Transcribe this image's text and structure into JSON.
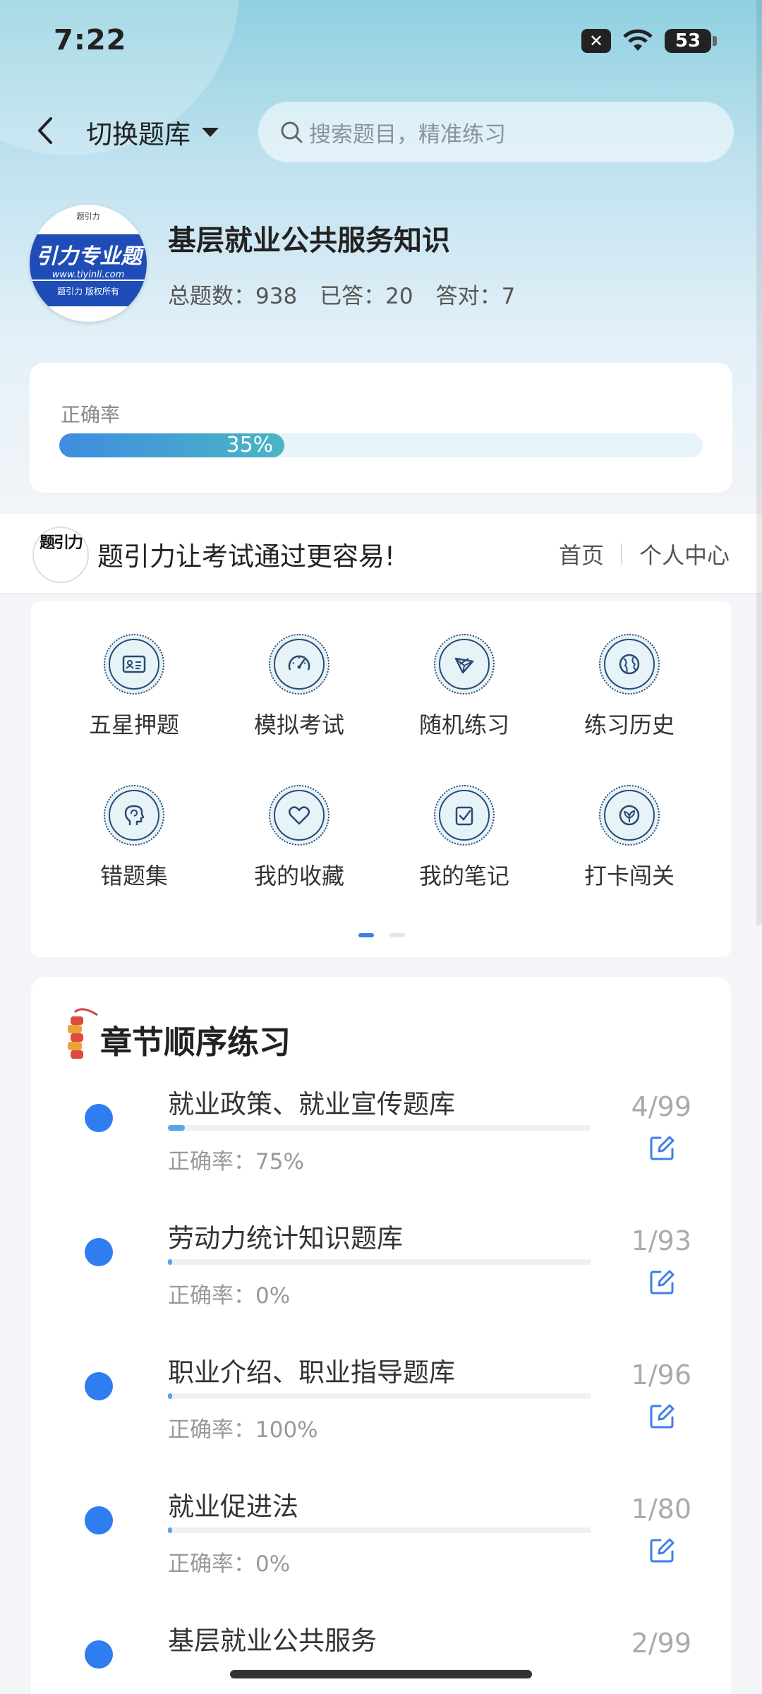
{
  "status_bar": {
    "time": "7:22",
    "battery": "53"
  },
  "topbar": {
    "switch_label": "切换题库",
    "search_placeholder": "搜索题目，精准练习"
  },
  "book": {
    "logo_top": "题引力",
    "logo_text": "引力专业题",
    "logo_url": "www.tiyinli.com",
    "logo_bottom": "题引力 版权所有",
    "title": "基层就业公共服务知识",
    "total_label": "总题数：938",
    "answered_label": "已答：20",
    "correct_label": "答对：7"
  },
  "accuracy": {
    "label": "正确率",
    "value_text": "35%",
    "value": 0.35
  },
  "banner": {
    "logo_text": "题引力",
    "slogan": "题引力让考试通过更容易!",
    "links": [
      "首页",
      "个人中心"
    ]
  },
  "grid": {
    "items": [
      {
        "label": "五星押题",
        "icon": "id-card-icon"
      },
      {
        "label": "模拟考试",
        "icon": "speedometer-icon"
      },
      {
        "label": "随机练习",
        "icon": "shuffle-icon"
      },
      {
        "label": "练习历史",
        "icon": "globe-icon"
      },
      {
        "label": "错题集",
        "icon": "head-icon"
      },
      {
        "label": "我的收藏",
        "icon": "heart-icon"
      },
      {
        "label": "我的笔记",
        "icon": "note-check-icon"
      },
      {
        "label": "打卡闯关",
        "icon": "leaf-icon"
      }
    ],
    "page_index": 1,
    "page_count": 2
  },
  "chapters": {
    "title": "章节顺序练习",
    "items": [
      {
        "name": "就业政策、就业宣传题库",
        "accuracy": "正确率：75%",
        "count": "4/99",
        "progress": 0.04
      },
      {
        "name": "劳动力统计知识题库",
        "accuracy": "正确率：0%",
        "count": "1/93",
        "progress": 0.01
      },
      {
        "name": "职业介绍、职业指导题库",
        "accuracy": "正确率：100%",
        "count": "1/96",
        "progress": 0.01
      },
      {
        "name": "就业促进法",
        "accuracy": "正确率：0%",
        "count": "1/80",
        "progress": 0.01
      },
      {
        "name": "基层就业公共服务",
        "accuracy": "",
        "count": "2/99",
        "progress": 0.02
      }
    ]
  },
  "colors": {
    "accent": "#2f7df0",
    "progress_fill": "#3f8de0"
  }
}
